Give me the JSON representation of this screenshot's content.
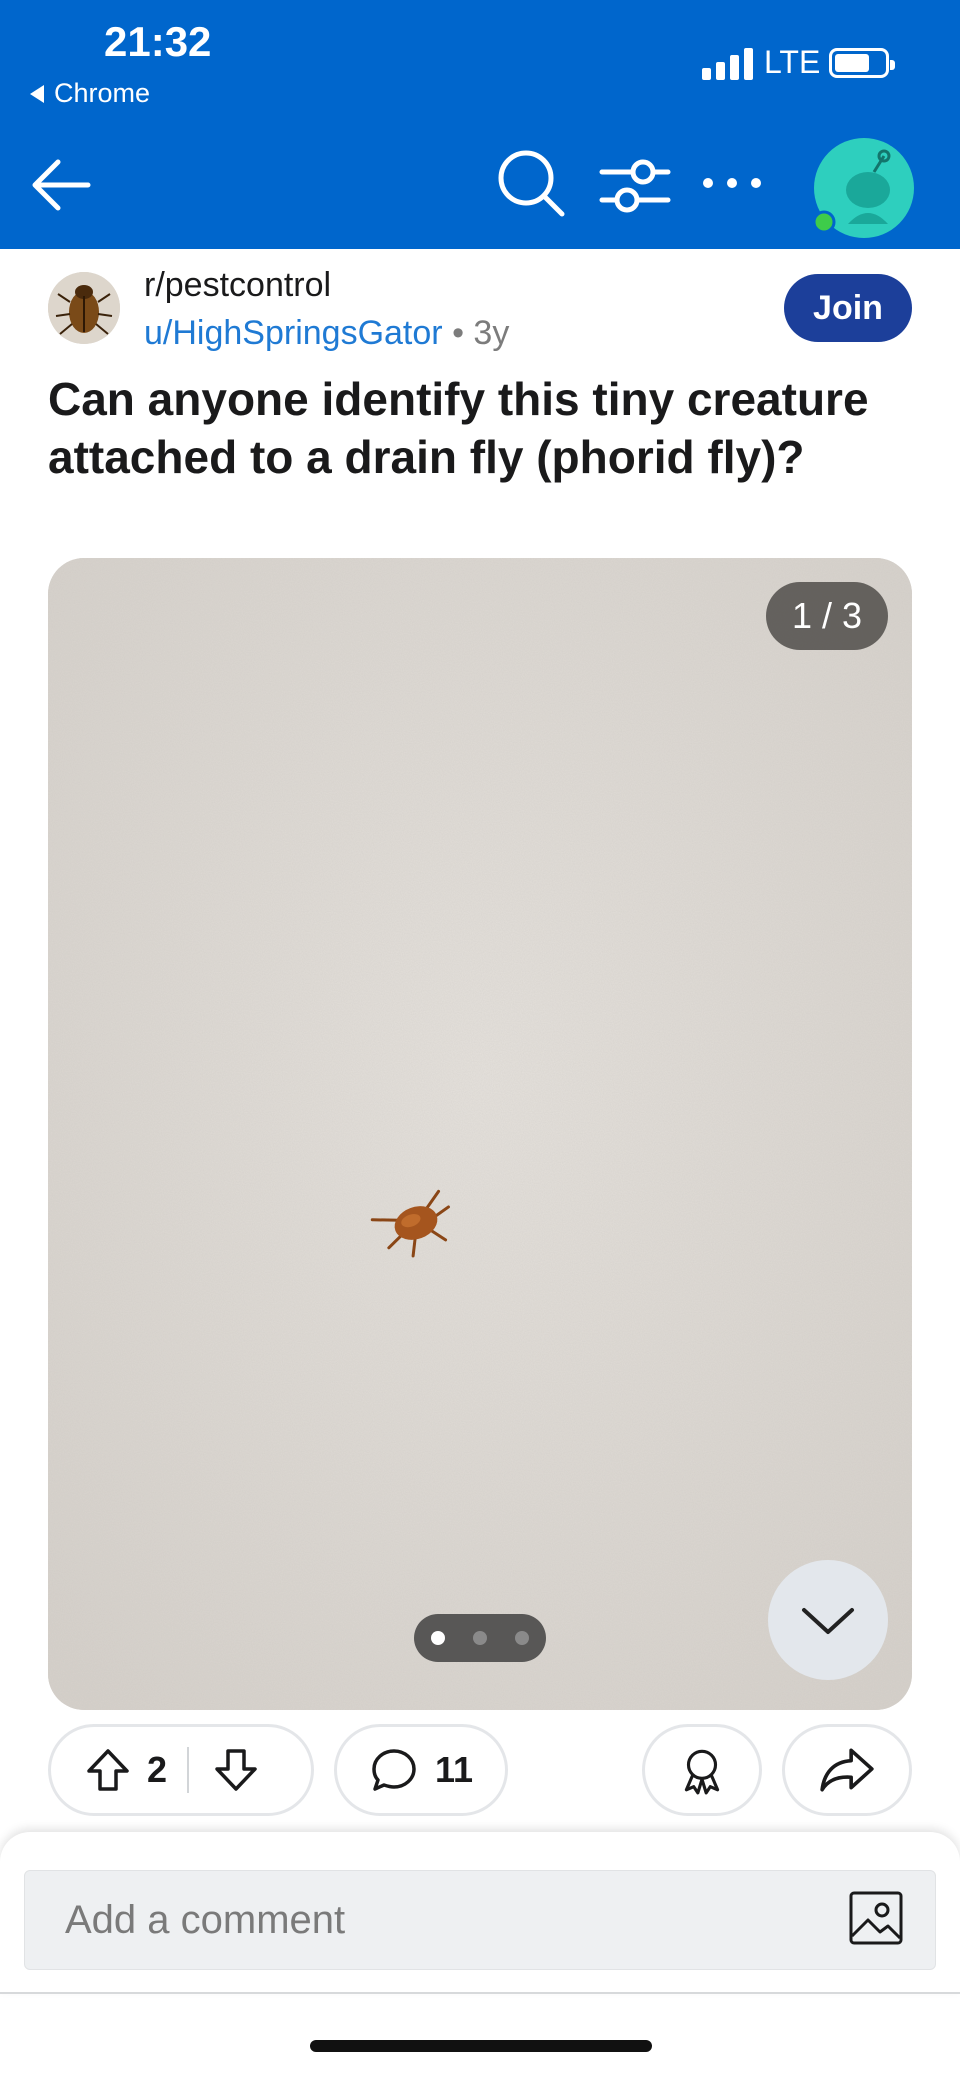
{
  "colors": {
    "brand": "#0066cc",
    "join": "#1c3f9a",
    "author_link": "#1f7ad4"
  },
  "status_bar": {
    "time": "21:32",
    "back_app": "Chrome",
    "network": "LTE",
    "battery_level": 0.7,
    "signal_bars": 4
  },
  "header": {
    "icons": [
      "back-arrow-icon",
      "search-icon",
      "filter-icon",
      "more-icon",
      "avatar-icon"
    ]
  },
  "post": {
    "subreddit": "r/pestcontrol",
    "author": "u/HighSpringsGator",
    "separator": "•",
    "age": "3y",
    "join_label": "Join",
    "title": "Can anyone identify this tiny creature attached to a drain fly (phorid fly)?",
    "media": {
      "counter": "1 / 3",
      "current_page": 1,
      "total_pages": 3
    }
  },
  "actions": {
    "upvotes": "2",
    "comments": "11"
  },
  "comment_box": {
    "placeholder": "Add a comment"
  }
}
